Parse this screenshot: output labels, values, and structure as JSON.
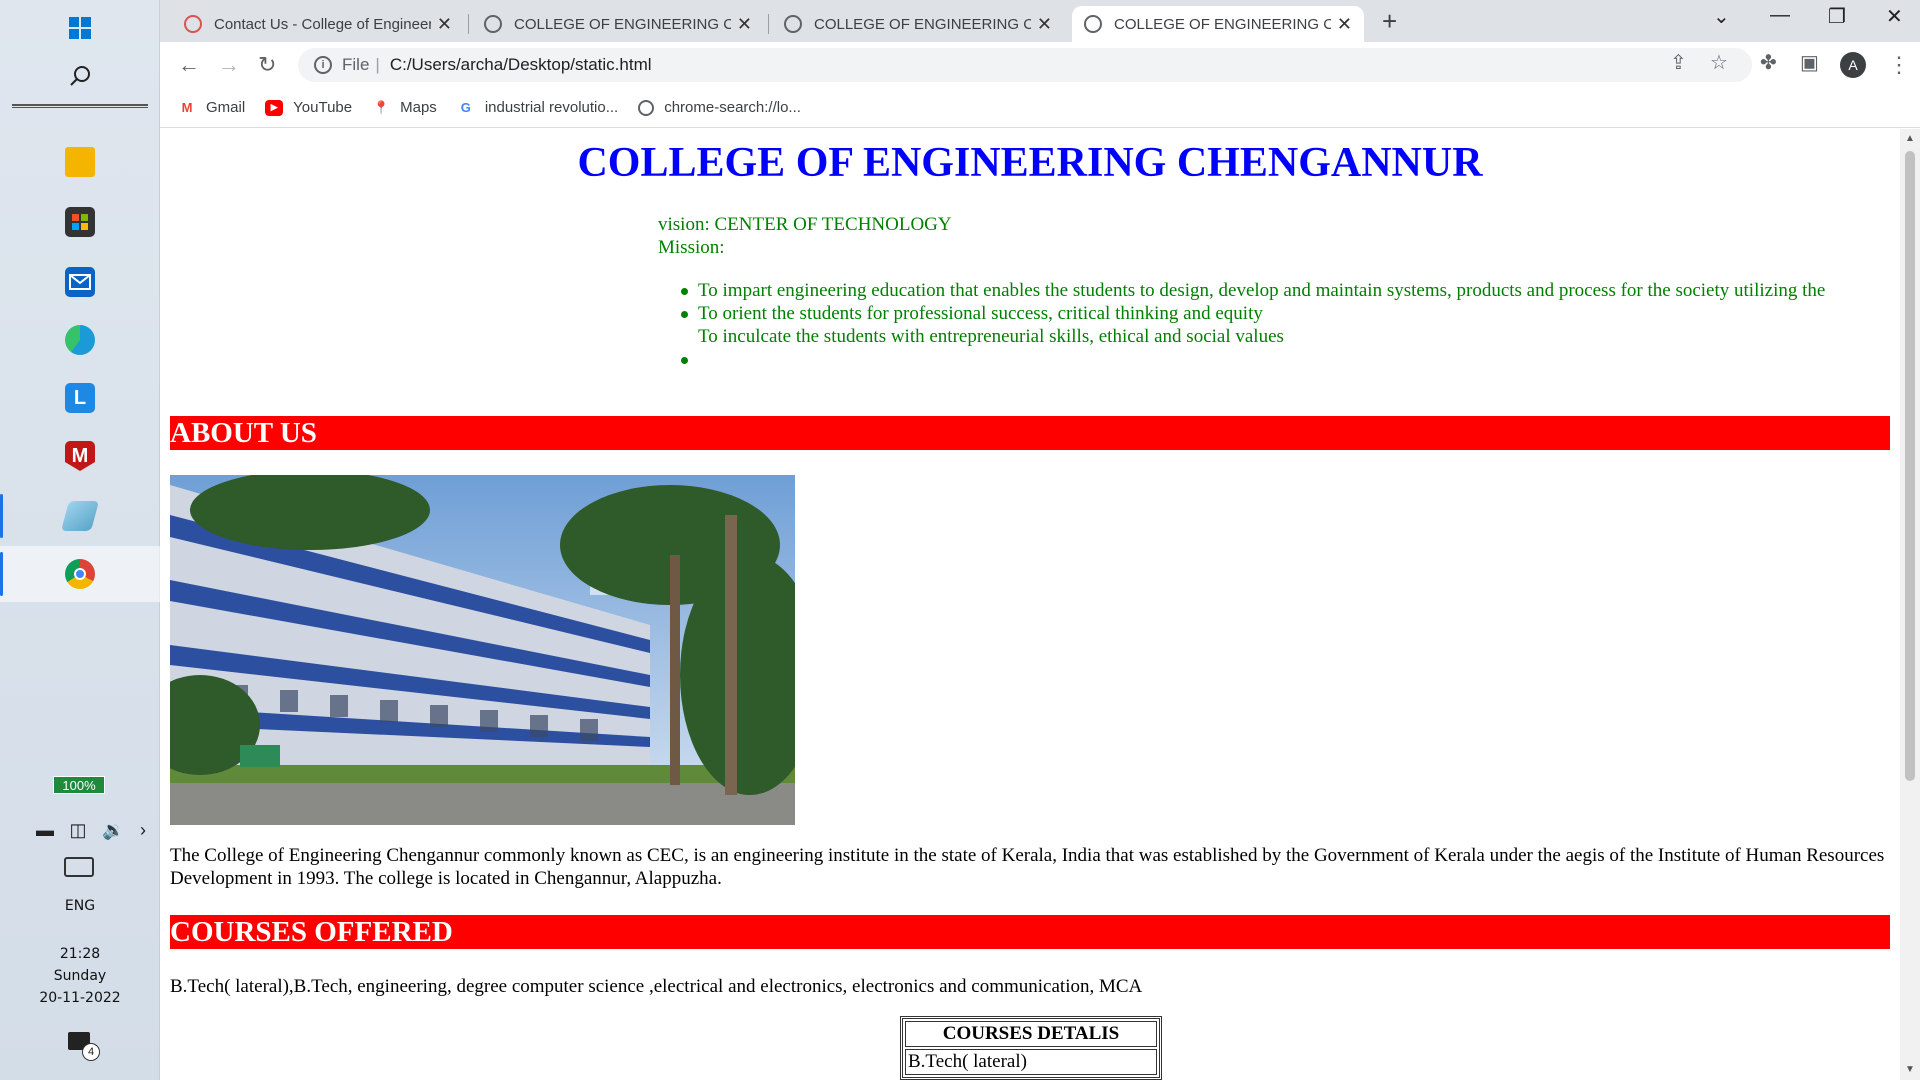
{
  "taskbar": {
    "apps": [
      {
        "name": "file-explorer",
        "color": "#f4b400"
      },
      {
        "name": "microsoft-store",
        "color": "#333333"
      },
      {
        "name": "mail",
        "color": "#0a64c8"
      },
      {
        "name": "edge",
        "color": "#1a9bd7"
      },
      {
        "name": "l-app",
        "color": "#1e88e5"
      },
      {
        "name": "mcafee",
        "color": "#c01818"
      },
      {
        "name": "notes-app",
        "color": "#6fb7d9"
      },
      {
        "name": "chrome",
        "color": "#db4437"
      }
    ],
    "battery": "100%",
    "language": "ENG",
    "time": "21:28",
    "day": "Sunday",
    "date": "20-11-2022",
    "notifications": "4"
  },
  "browser": {
    "tabs": [
      {
        "title": "Contact Us - College of Engineeri",
        "favicon": "cec-logo-icon",
        "active": false
      },
      {
        "title": "COLLEGE OF ENGINEERING CHEN",
        "favicon": "globe-icon",
        "active": false
      },
      {
        "title": "COLLEGE OF ENGINEERING CHEN",
        "favicon": "globe-icon",
        "active": false
      },
      {
        "title": "COLLEGE OF ENGINEERING CHEN",
        "favicon": "globe-icon",
        "active": true
      }
    ],
    "address": {
      "scheme": "File",
      "path": "C:/Users/archa/Desktop/static.html"
    },
    "profile_initial": "A",
    "bookmarks": [
      {
        "label": "Gmail",
        "icon": "gmail-icon"
      },
      {
        "label": "YouTube",
        "icon": "youtube-icon"
      },
      {
        "label": "Maps",
        "icon": "maps-icon"
      },
      {
        "label": "industrial revolutio...",
        "icon": "google-icon"
      },
      {
        "label": "chrome-search://lo...",
        "icon": "globe-icon"
      }
    ]
  },
  "page": {
    "title": "COLLEGE OF ENGINEERING CHENGANNUR",
    "vision": "vision: CENTER OF TECHNOLOGY",
    "mission_label": "Mission:",
    "mission_items": [
      "To impart engineering education that enables the students to design, develop and maintain systems, products and process for the society utilizing the",
      "To orient the students for professional success, critical thinking and equity",
      "To inculcate the students with entrepreneurial skills, ethical and social values",
      ""
    ],
    "about_heading": "ABOUT US",
    "about_text": "The College of Engineering Chengannur commonly known as CEC, is an engineering institute in the state of Kerala, India that was established by the Government of Kerala under the aegis of the Institute of Human Resources Development in 1993. The college is located in Chengannur, Alappuzha.",
    "courses_heading": "COURSES OFFERED",
    "courses_text": "B.Tech( lateral),B.Tech, engineering, degree computer science ,electrical and electronics, electronics and communication, MCA",
    "courses_table": {
      "header": "COURSES DETALIS",
      "rows": [
        "B.Tech( lateral)"
      ]
    },
    "colors": {
      "title": "#0000ff",
      "mission": "#008000",
      "heading_bg": "#ff0000"
    }
  }
}
